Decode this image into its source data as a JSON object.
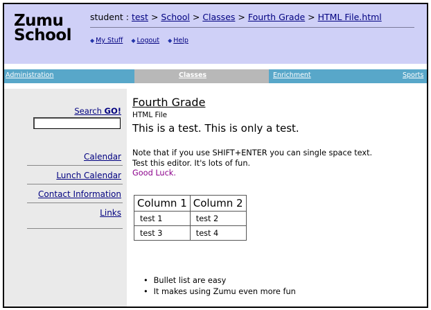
{
  "logo": {
    "line1": "Zumu",
    "line2": "School"
  },
  "breadcrumb": {
    "prefix": "student : ",
    "items": [
      "test",
      "School",
      "Classes",
      "Fourth Grade",
      "HTML File.html"
    ],
    "separator": " > "
  },
  "quicklinks": [
    "My Stuff",
    "Logout",
    "Help"
  ],
  "nav": [
    "Administration",
    "Classes",
    "Enrichment",
    "Sports"
  ],
  "sidebar": {
    "search_label": "Search",
    "go_label": "GO!",
    "search_value": "",
    "links": [
      "Calendar",
      "Lunch Calendar",
      "Contact Information",
      "Links"
    ]
  },
  "content": {
    "title": "Fourth Grade",
    "subtitle": "HTML File",
    "headline": "This is a test. This is only a test.",
    "note_line1": "Note that if you use SHIFT+ENTER you can single space text.",
    "note_line2": "Test this editor. It's lots of fun.",
    "good_luck": "Good Luck.",
    "table": {
      "headers": [
        "Column 1",
        "Column 2"
      ],
      "rows": [
        [
          "test 1",
          "test 2"
        ],
        [
          "test 3",
          "test 4"
        ]
      ]
    },
    "bullets": [
      "Bullet list are easy",
      "It makes using Zumu even more fun"
    ]
  },
  "colors": {
    "header_bg": "#cfd0f7",
    "navbar_bg": "#58a7c9",
    "nav_active_bg": "#b8b8b8",
    "sidebar_bg": "#eaeaea",
    "link": "#000080",
    "good_luck": "#8b008b"
  }
}
